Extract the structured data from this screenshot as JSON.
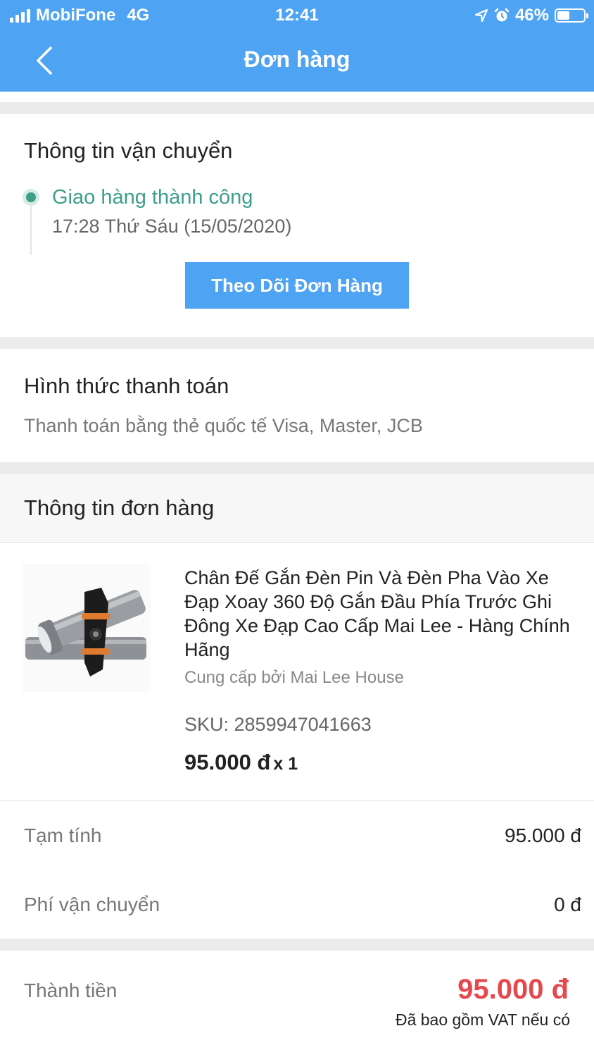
{
  "status_bar": {
    "carrier": "MobiFone",
    "network": "4G",
    "time": "12:41",
    "battery": "46%",
    "battery_level": 0.46
  },
  "header": {
    "title": "Đơn hàng",
    "back_icon": "chevron-left-icon"
  },
  "shipping": {
    "title": "Thông tin vận chuyển",
    "status": "Giao hàng thành công",
    "datetime": "17:28 Thứ Sáu (15/05/2020)",
    "track_button": "Theo Dõi Đơn Hàng",
    "status_color": "#3d9f8a"
  },
  "payment": {
    "title": "Hình thức thanh toán",
    "method": "Thanh toán bằng thẻ quốc tế Visa, Master, JCB"
  },
  "order": {
    "title": "Thông tin đơn hàng",
    "product": {
      "name": "Chân Đế Gắn Đèn Pin Và Đèn Pha Vào Xe Đạp Xoay 360 Độ Gắn Đầu Phía Trước Ghi Đông Xe Đạp Cao Cấp Mai Lee - Hàng Chính Hãng",
      "seller": "Cung cấp bởi Mai Lee House",
      "sku": "SKU: 2859947041663",
      "price": "95.000 đ",
      "quantity": "x 1"
    }
  },
  "summary": {
    "subtotal_label": "Tạm tính",
    "subtotal_value": "95.000 đ",
    "shipping_label": "Phí vận chuyển",
    "shipping_value": "0 đ",
    "total_label": "Thành tiền",
    "total_value": "95.000 đ",
    "vat_note": "Đã bao gồm VAT nếu có",
    "total_color": "#e5484d"
  },
  "colors": {
    "brand": "#4ea3f2"
  }
}
